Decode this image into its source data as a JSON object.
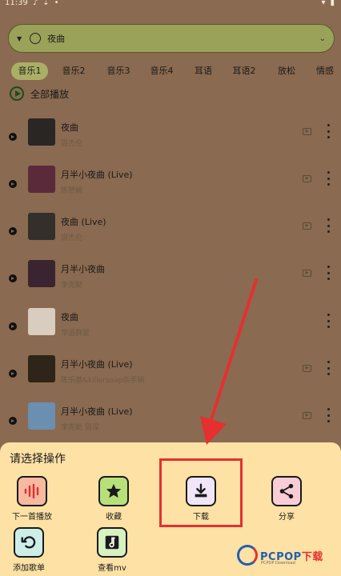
{
  "status_bar": {
    "time": "11:39"
  },
  "search": {
    "query": "夜曲"
  },
  "tabs": [
    {
      "label": "音乐1",
      "active": true
    },
    {
      "label": "音乐2",
      "active": false
    },
    {
      "label": "音乐3",
      "active": false
    },
    {
      "label": "音乐4",
      "active": false
    },
    {
      "label": "耳语",
      "active": false
    },
    {
      "label": "耳语2",
      "active": false
    },
    {
      "label": "放松",
      "active": false
    },
    {
      "label": "情感",
      "active": false
    }
  ],
  "play_all": {
    "label": "全部播放"
  },
  "songs": [
    {
      "title": "夜曲",
      "artist": "周杰伦",
      "has_mv": true,
      "cover_color": "#2a2624"
    },
    {
      "title": "月半小夜曲 (Live)",
      "artist": "陈慧娴",
      "has_mv": true,
      "cover_color": "#5a2a3a"
    },
    {
      "title": "夜曲 (Live)",
      "artist": "周杰伦",
      "has_mv": true,
      "cover_color": "#33302c"
    },
    {
      "title": "月半小夜曲",
      "artist": "李克勤",
      "has_mv": true,
      "cover_color": "#3a2430"
    },
    {
      "title": "夜曲",
      "artist": "华语群星",
      "has_mv": false,
      "cover_color": "#d9cdbf"
    },
    {
      "title": "月半小夜曲 (Live)",
      "artist": "陈乐基&killersoap杀手锏",
      "has_mv": true,
      "cover_color": "#2e2418"
    },
    {
      "title": "月半小夜曲 (Live)",
      "artist": "李克勤 周深",
      "has_mv": true,
      "cover_color": "#6a8fb0"
    }
  ],
  "sheet": {
    "title": "请选择操作",
    "actions": [
      {
        "label": "下一首播放",
        "icon": "audio-wave-icon",
        "bg": "#f7b9a0"
      },
      {
        "label": "收藏",
        "icon": "star-icon",
        "bg": "#b8e07a"
      },
      {
        "label": "下载",
        "icon": "download-icon",
        "bg": "#f1e6f7"
      },
      {
        "label": "分享",
        "icon": "share-icon",
        "bg": "#f9cdd6"
      },
      {
        "label": "添加歌单",
        "icon": "add-to-playlist-icon",
        "bg": "#cdeee8"
      },
      {
        "label": "查看mv",
        "icon": "music-note-icon",
        "bg": "#d6f2c0"
      }
    ]
  },
  "watermark": {
    "brand_a": "PCPOP",
    "brand_b": "下载",
    "sub": "PCPOP Download"
  },
  "colors": {
    "accent": "#a9b066",
    "highlight": "#e53030",
    "sheet_bg": "#fde1a5",
    "page_bg": "#8a6a50"
  }
}
